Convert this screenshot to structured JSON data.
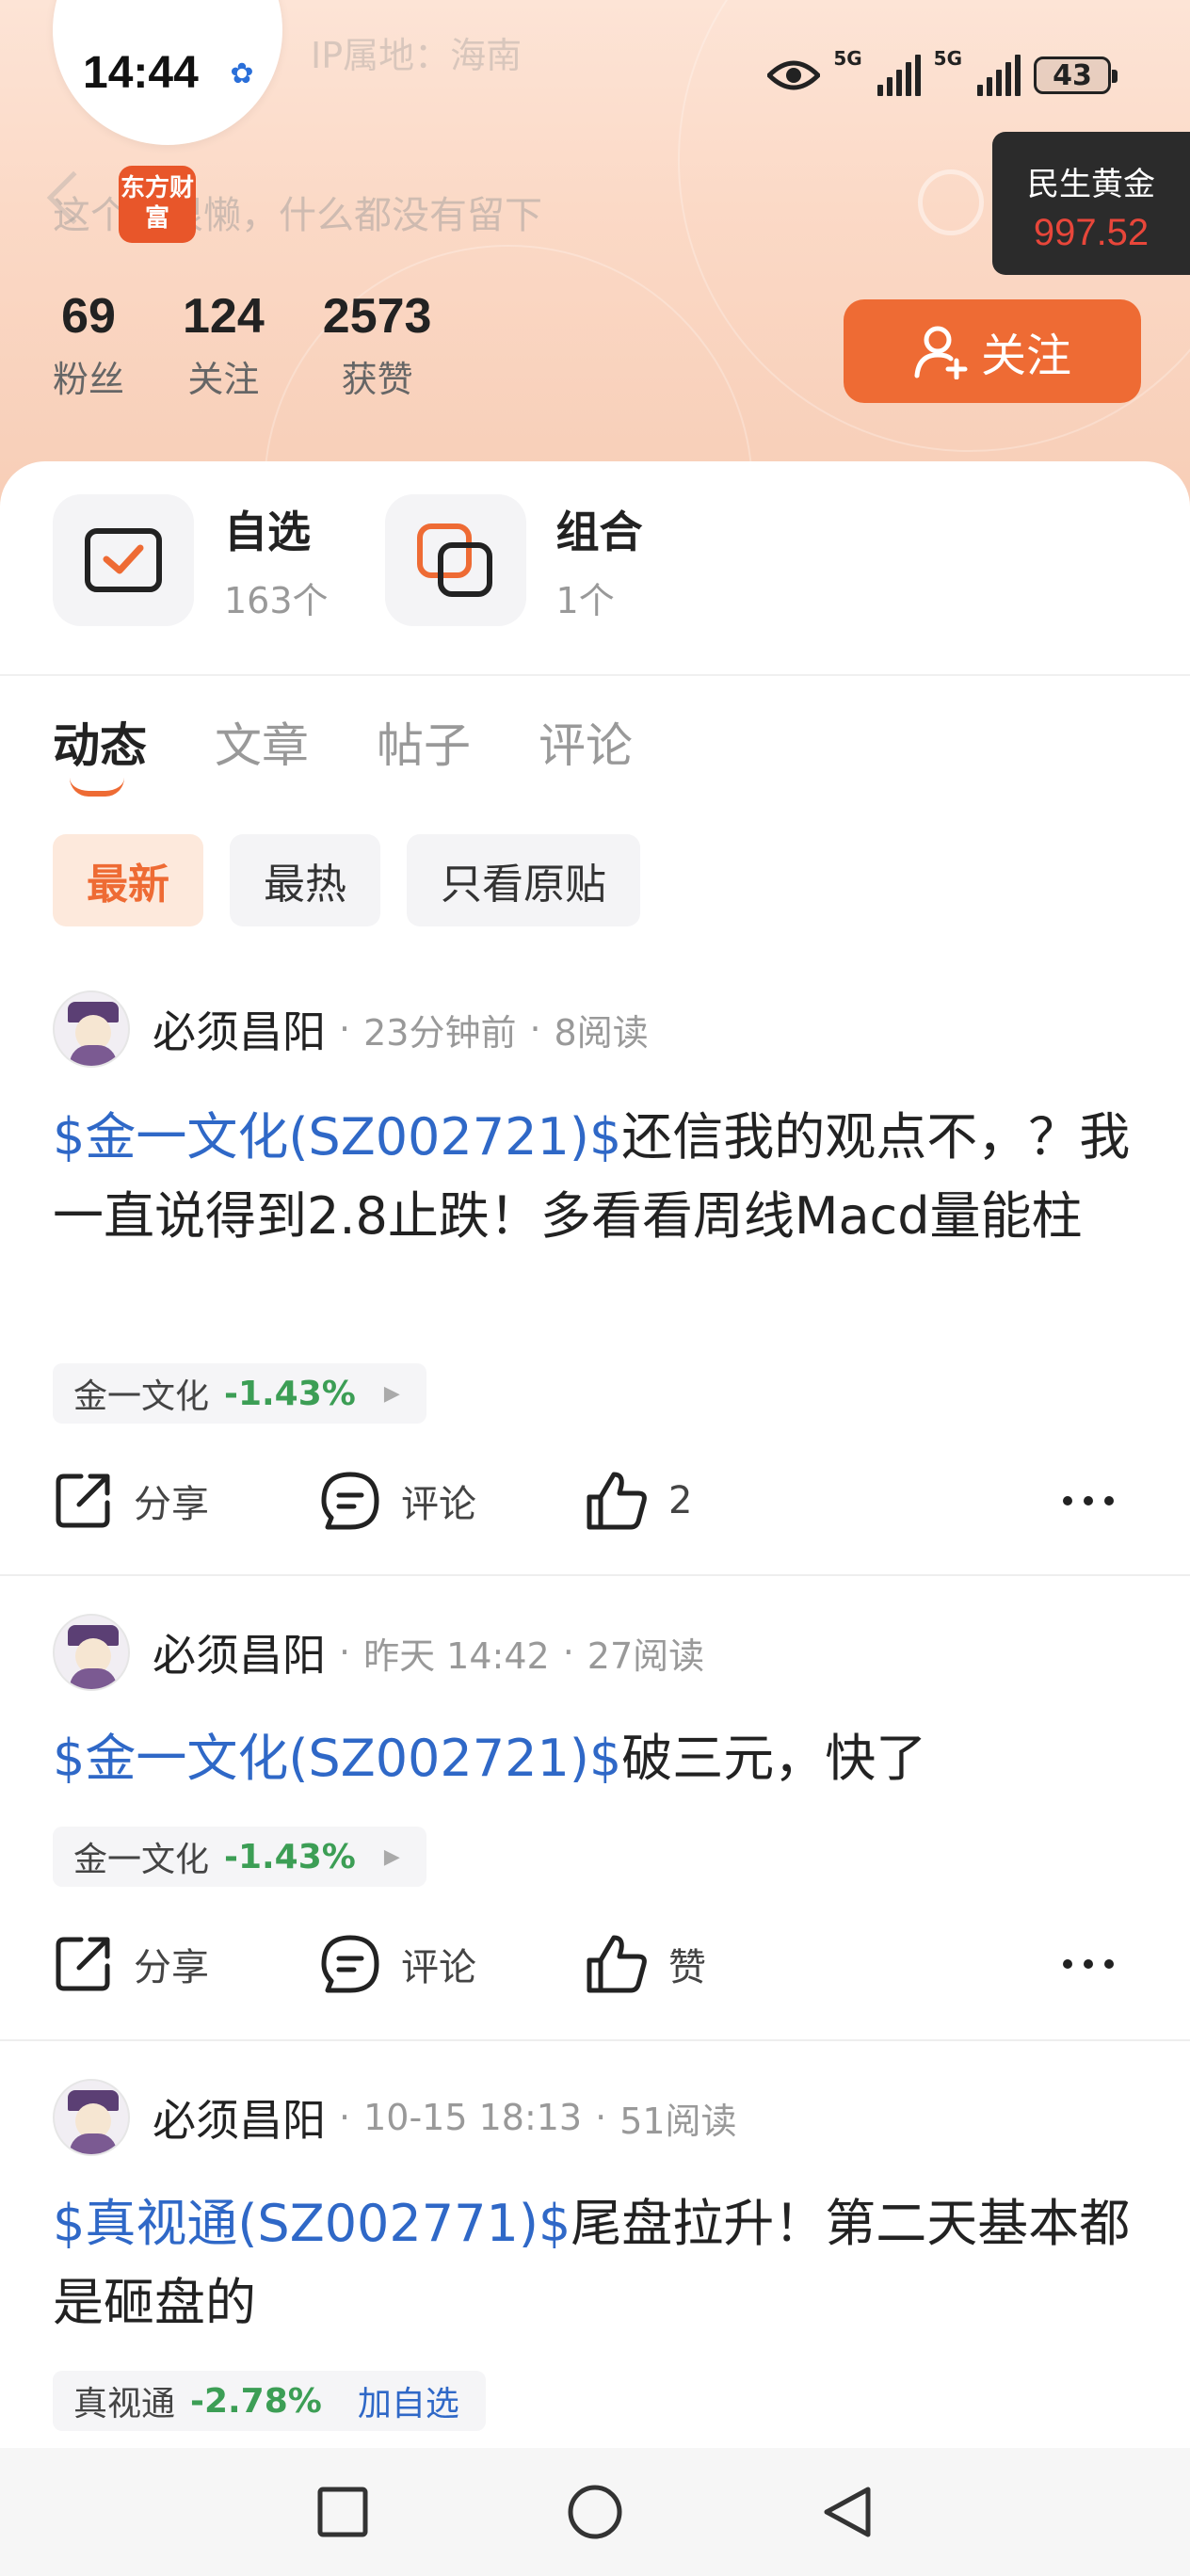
{
  "status_bar": {
    "time": "14:44",
    "battery": "43",
    "network_1": "5G",
    "network_2": "5G"
  },
  "header": {
    "ip_location": "IP属地：海南",
    "bio": "这个人很懒，什么都没有留下",
    "app_badge": "东方财富",
    "gold_ticker": {
      "name": "民生黄金",
      "price": "997.52"
    }
  },
  "profile_stats": [
    {
      "value": "69",
      "label": "粉丝"
    },
    {
      "value": "124",
      "label": "关注"
    },
    {
      "value": "2573",
      "label": "获赞"
    }
  ],
  "follow_button": "关注",
  "quick_links": [
    {
      "title": "自选",
      "subtitle": "163个"
    },
    {
      "title": "组合",
      "subtitle": "1个"
    }
  ],
  "tabs": [
    "动态",
    "文章",
    "帖子",
    "评论"
  ],
  "filters": [
    "最新",
    "最热",
    "只看原贴"
  ],
  "posts": [
    {
      "author": "必须昌阳",
      "time": "23分钟前",
      "reads": "8阅读",
      "stock_link": "$金一文化(SZ002721)$",
      "text": "还信我的观点不，？我一直说得到2.8止跌！多看看周线Macd量能柱",
      "tag_name": "金一文化",
      "tag_change": "-1.43%",
      "share": "分享",
      "comment": "评论",
      "like": "2"
    },
    {
      "author": "必须昌阳",
      "time": "昨天 14:42",
      "reads": "27阅读",
      "stock_link": "$金一文化(SZ002721)$",
      "text": "破三元，快了",
      "tag_name": "金一文化",
      "tag_change": "-1.43%",
      "share": "分享",
      "comment": "评论",
      "like": "赞"
    },
    {
      "author": "必须昌阳",
      "time": "10-15 18:13",
      "reads": "51阅读",
      "stock_link": "$真视通(SZ002771)$",
      "text": "尾盘拉升！第二天基本都是砸盘的",
      "tag_name": "真视通",
      "tag_change": "-2.78%",
      "tag_action": "加自选"
    }
  ],
  "colors": {
    "accent": "#ee6b34",
    "stock_link": "#2f68c7",
    "down": "#3c9e55",
    "ticker_price": "#e8463a"
  }
}
